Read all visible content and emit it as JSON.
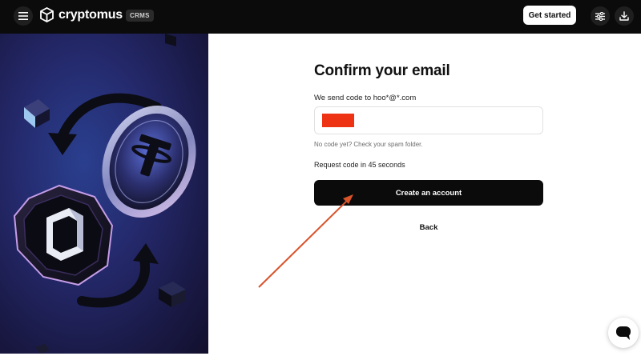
{
  "header": {
    "brand": "cryptomus",
    "product_badge": "CRMS",
    "get_started_label": "Get started",
    "icons": [
      "menu-icon",
      "logo-cube-icon",
      "sliders-icon",
      "download-icon"
    ]
  },
  "form": {
    "title": "Confirm your email",
    "subtitle": "We send code to hoo*@*.com",
    "code_input_value": "",
    "spam_note": "No code yet? Check your spam folder.",
    "resend_text": "Request code in 45 seconds",
    "create_button_label": "Create an account",
    "back_label": "Back"
  },
  "chat": {
    "icon": "chat-bubble-icon"
  },
  "colors": {
    "header_bg": "#0b0b0b",
    "primary_button": "#0b0b0b",
    "redaction": "#ee3214",
    "annotation_arrow": "#d9532b",
    "illustration_bg": "#24296b"
  }
}
